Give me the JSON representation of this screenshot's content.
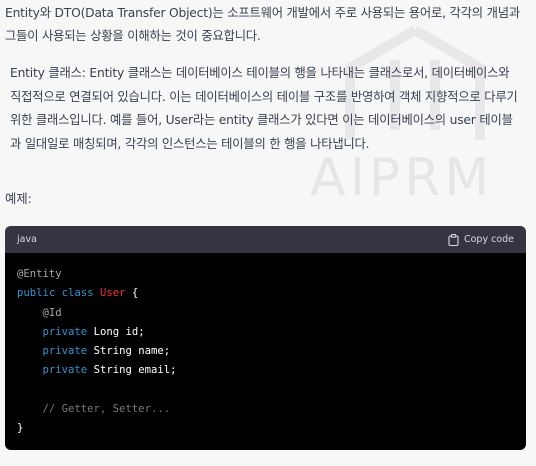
{
  "intro_text": "Entity와 DTO(Data Transfer Object)는 소프트웨어 개발에서 주로 사용되는 용어로, 각각의 개념과 그들이 사용되는 상황을 이해하는 것이 중요합니다.",
  "entity_paragraph": "Entity 클래스: Entity 클래스는 데이터베이스 테이블의 행을 나타내는 클래스로서, 데이터베이스와 직접적으로 연결되어 있습니다. 이는 데이터베이스의 테이블 구조를 반영하여 객체 지향적으로 다루기 위한 클래스입니다. 예를 들어, User라는 entity 클래스가 있다면 이는 데이터베이스의 user 테이블과 일대일로 매칭되며, 각각의 인스턴스는 테이블의 한 행을 나타냅니다.",
  "example_label": "예제:",
  "watermark": "AIPRM",
  "code": {
    "language": "java",
    "copy_label": "Copy code",
    "line1": "@Entity",
    "line2_kw": "public class",
    "line2_cls": "User",
    "line2_brace": "{",
    "line3": "@Id",
    "line4_kw": "private",
    "line4_rest": "Long id;",
    "line5_kw": "private",
    "line5_rest": "String name;",
    "line6_kw": "private",
    "line6_rest": "String email;",
    "line8": "// Getter, Setter...",
    "line9": "}"
  },
  "colors": {
    "keyword": "#2e95d3",
    "class_name": "#f22c3d",
    "comment": "#7a7a7a",
    "code_bg": "#000000",
    "code_header_bg": "#343541"
  }
}
